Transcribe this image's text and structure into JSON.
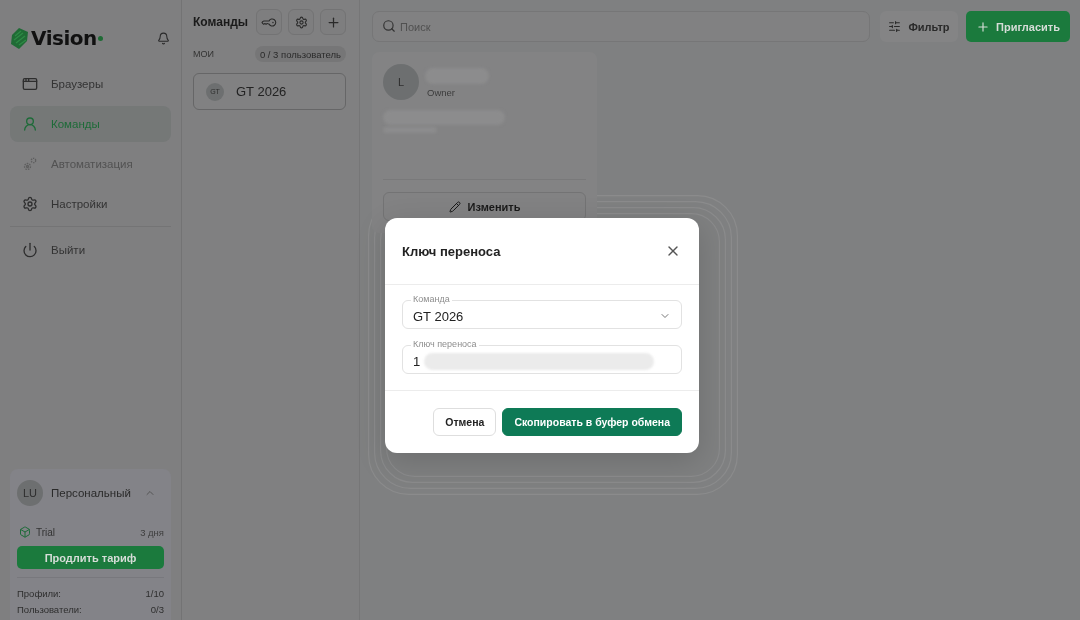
{
  "sidebar": {
    "logo": "Vision",
    "nav_items": [
      {
        "label": "Браузеры",
        "selected": false,
        "disabled": false
      },
      {
        "label": "Команды",
        "selected": true,
        "disabled": false
      },
      {
        "label": "Автоматизация",
        "selected": false,
        "disabled": true
      },
      {
        "label": "Настройки",
        "selected": false,
        "disabled": false
      }
    ],
    "logout": "Выйти",
    "plan_card": {
      "initials": "LU",
      "name": "Персональный",
      "expanded": true,
      "plan": "Trial",
      "days_left": "3 дня",
      "renew_button": "Продлить тариф",
      "stats": [
        {
          "label": "Профили:",
          "value": "1/10"
        },
        {
          "label": "Пользователи:",
          "value": "0/3"
        }
      ]
    }
  },
  "teams_panel": {
    "title": "Команды",
    "group_label": "МОИ",
    "usage_badge": "0 / 3 пользователь",
    "teams": [
      {
        "initials": "GT",
        "name": "GT 2026",
        "selected": true
      }
    ]
  },
  "toolbar": {
    "search": {
      "placeholder": "Поиск"
    },
    "filter_button": "Фильтр",
    "invite_button": "Пригласить"
  },
  "member_card": {
    "initial": "L",
    "role": "Owner",
    "edit_button": "Изменить"
  },
  "dialog": {
    "title": "Ключ переноса",
    "fields": [
      {
        "kind": "select",
        "label": "Команда",
        "value": "GT 2026",
        "redacted": false
      },
      {
        "kind": "text",
        "label": "Ключ переноса",
        "value": "1",
        "redacted": true
      }
    ],
    "buttons": [
      {
        "label": "Отмена",
        "primary": false
      },
      {
        "label": "Скопировать в буфер обмена",
        "primary": true
      }
    ]
  }
}
